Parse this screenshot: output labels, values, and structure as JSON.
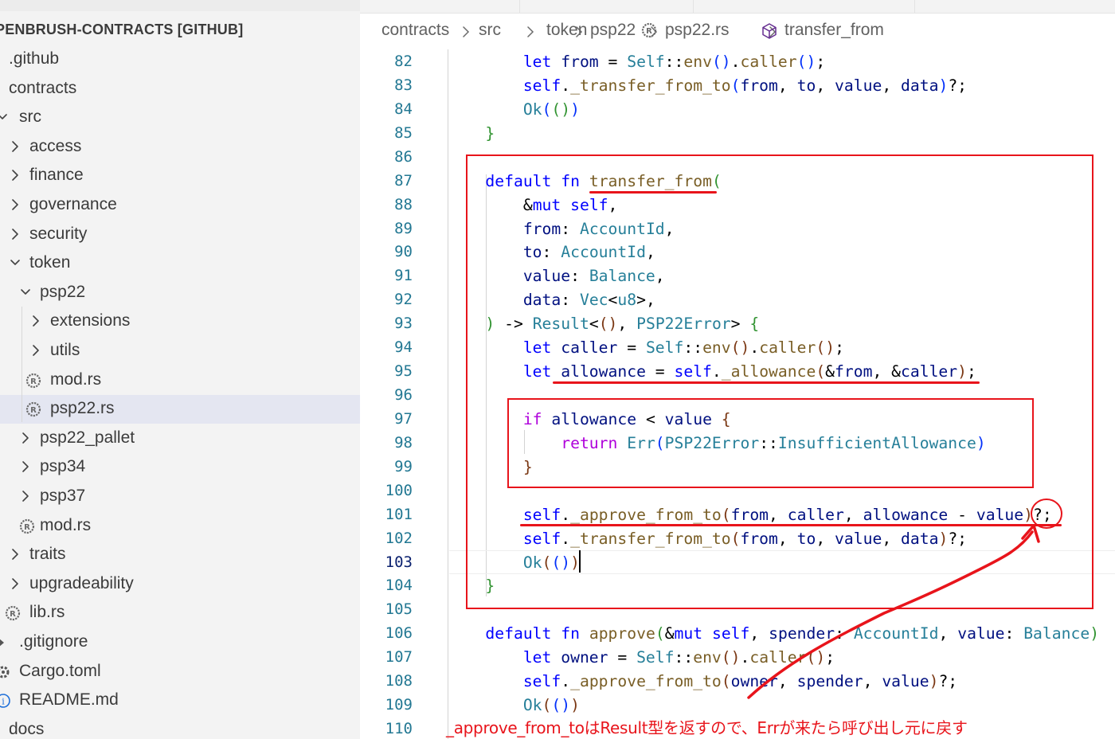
{
  "explorer": {
    "root_title": "PENBRUSH-CONTRACTS [GITHUB]",
    "items": [
      {
        "label": ".github",
        "depth": 0,
        "kind": "folder",
        "expanded": false
      },
      {
        "label": "contracts",
        "depth": 0,
        "kind": "folder",
        "expanded": true
      },
      {
        "label": "src",
        "depth": 1,
        "kind": "folder",
        "expanded": true
      },
      {
        "label": "access",
        "depth": 2,
        "kind": "folder",
        "expanded": false
      },
      {
        "label": "finance",
        "depth": 2,
        "kind": "folder",
        "expanded": false
      },
      {
        "label": "governance",
        "depth": 2,
        "kind": "folder",
        "expanded": false
      },
      {
        "label": "security",
        "depth": 2,
        "kind": "folder",
        "expanded": false
      },
      {
        "label": "token",
        "depth": 2,
        "kind": "folder",
        "expanded": true
      },
      {
        "label": "psp22",
        "depth": 3,
        "kind": "folder",
        "expanded": true
      },
      {
        "label": "extensions",
        "depth": 4,
        "kind": "folder",
        "expanded": false
      },
      {
        "label": "utils",
        "depth": 4,
        "kind": "folder",
        "expanded": false
      },
      {
        "label": "mod.rs",
        "depth": 4,
        "kind": "rust-file"
      },
      {
        "label": "psp22.rs",
        "depth": 4,
        "kind": "rust-file",
        "selected": true
      },
      {
        "label": "psp22_pallet",
        "depth": 3,
        "kind": "folder",
        "expanded": false
      },
      {
        "label": "psp34",
        "depth": 3,
        "kind": "folder",
        "expanded": false
      },
      {
        "label": "psp37",
        "depth": 3,
        "kind": "folder",
        "expanded": false
      },
      {
        "label": "mod.rs",
        "depth": 3,
        "kind": "rust-file"
      },
      {
        "label": "traits",
        "depth": 2,
        "kind": "folder",
        "expanded": false
      },
      {
        "label": "upgradeability",
        "depth": 2,
        "kind": "folder",
        "expanded": false
      },
      {
        "label": "lib.rs",
        "depth": 1,
        "kind": "rust-file"
      },
      {
        "label": ".gitignore",
        "depth": 1,
        "kind": "git-file"
      },
      {
        "label": "Cargo.toml",
        "depth": 1,
        "kind": "toml-file"
      },
      {
        "label": "README.md",
        "depth": 1,
        "kind": "info-file"
      },
      {
        "label": "docs",
        "depth": 0,
        "kind": "folder",
        "expanded": false
      }
    ]
  },
  "breadcrumb": {
    "items": [
      "contracts",
      "src",
      "token",
      "psp22",
      "psp22.rs",
      "transfer_from"
    ]
  },
  "editor": {
    "current_line": 103,
    "lines": [
      {
        "n": 82,
        "tokens": [
          [
            "pn",
            "        "
          ],
          [
            "kw",
            "let"
          ],
          [
            "pn",
            " "
          ],
          [
            "vr",
            "from"
          ],
          [
            "pn",
            " = "
          ],
          [
            "ty",
            "Self"
          ],
          [
            "pn",
            "::"
          ],
          [
            "fn",
            "env"
          ],
          [
            "b1",
            "("
          ],
          [
            "b1",
            ")"
          ],
          [
            "pn",
            "."
          ],
          [
            "fn",
            "caller"
          ],
          [
            "b1",
            "("
          ],
          [
            "b1",
            ")"
          ],
          [
            "pn",
            ";"
          ]
        ]
      },
      {
        "n": 83,
        "tokens": [
          [
            "pn",
            "        "
          ],
          [
            "kw",
            "self"
          ],
          [
            "pn",
            "."
          ],
          [
            "fn",
            "_transfer_from_to"
          ],
          [
            "b1",
            "("
          ],
          [
            "vr",
            "from"
          ],
          [
            "pn",
            ", "
          ],
          [
            "vr",
            "to"
          ],
          [
            "pn",
            ", "
          ],
          [
            "vr",
            "value"
          ],
          [
            "pn",
            ", "
          ],
          [
            "vr",
            "data"
          ],
          [
            "b1",
            ")"
          ],
          [
            "pn",
            "?;"
          ]
        ]
      },
      {
        "n": 84,
        "tokens": [
          [
            "pn",
            "        "
          ],
          [
            "ty",
            "Ok"
          ],
          [
            "b1",
            "("
          ],
          [
            "b2",
            "("
          ],
          [
            "b2",
            ")"
          ],
          [
            "b1",
            ")"
          ]
        ]
      },
      {
        "n": 85,
        "tokens": [
          [
            "pn",
            "    "
          ],
          [
            "b2",
            "}"
          ]
        ]
      },
      {
        "n": 86,
        "tokens": []
      },
      {
        "n": 87,
        "tokens": [
          [
            "pn",
            "    "
          ],
          [
            "kw",
            "default"
          ],
          [
            "pn",
            " "
          ],
          [
            "kw",
            "fn"
          ],
          [
            "pn",
            " "
          ],
          [
            "fn",
            "transfer_from"
          ],
          [
            "b2",
            "("
          ]
        ]
      },
      {
        "n": 88,
        "tokens": [
          [
            "pn",
            "        &"
          ],
          [
            "kw",
            "mut"
          ],
          [
            "pn",
            " "
          ],
          [
            "kw",
            "self"
          ],
          [
            "pn",
            ","
          ]
        ]
      },
      {
        "n": 89,
        "tokens": [
          [
            "pn",
            "        "
          ],
          [
            "vr",
            "from"
          ],
          [
            "pn",
            ": "
          ],
          [
            "ty",
            "AccountId"
          ],
          [
            "pn",
            ","
          ]
        ]
      },
      {
        "n": 90,
        "tokens": [
          [
            "pn",
            "        "
          ],
          [
            "vr",
            "to"
          ],
          [
            "pn",
            ": "
          ],
          [
            "ty",
            "AccountId"
          ],
          [
            "pn",
            ","
          ]
        ]
      },
      {
        "n": 91,
        "tokens": [
          [
            "pn",
            "        "
          ],
          [
            "vr",
            "value"
          ],
          [
            "pn",
            ": "
          ],
          [
            "ty",
            "Balance"
          ],
          [
            "pn",
            ","
          ]
        ]
      },
      {
        "n": 92,
        "tokens": [
          [
            "pn",
            "        "
          ],
          [
            "vr",
            "data"
          ],
          [
            "pn",
            ": "
          ],
          [
            "ty",
            "Vec"
          ],
          [
            "pn",
            "<"
          ],
          [
            "ty",
            "u8"
          ],
          [
            "pn",
            ">,"
          ]
        ]
      },
      {
        "n": 93,
        "tokens": [
          [
            "pn",
            "    "
          ],
          [
            "b2",
            ")"
          ],
          [
            "pn",
            " -> "
          ],
          [
            "ty",
            "Result"
          ],
          [
            "pn",
            "<"
          ],
          [
            "b3",
            "("
          ],
          [
            "b3",
            ")"
          ],
          [
            "pn",
            ", "
          ],
          [
            "ty",
            "PSP22Error"
          ],
          [
            "pn",
            "> "
          ],
          [
            "b2",
            "{"
          ]
        ]
      },
      {
        "n": 94,
        "tokens": [
          [
            "pn",
            "        "
          ],
          [
            "kw",
            "let"
          ],
          [
            "pn",
            " "
          ],
          [
            "vr",
            "caller"
          ],
          [
            "pn",
            " = "
          ],
          [
            "ty",
            "Self"
          ],
          [
            "pn",
            "::"
          ],
          [
            "fn",
            "env"
          ],
          [
            "b3",
            "("
          ],
          [
            "b3",
            ")"
          ],
          [
            "pn",
            "."
          ],
          [
            "fn",
            "caller"
          ],
          [
            "b3",
            "("
          ],
          [
            "b3",
            ")"
          ],
          [
            "pn",
            ";"
          ]
        ]
      },
      {
        "n": 95,
        "tokens": [
          [
            "pn",
            "        "
          ],
          [
            "kw",
            "let"
          ],
          [
            "pn",
            " "
          ],
          [
            "vr",
            "allowance"
          ],
          [
            "pn",
            " = "
          ],
          [
            "kw",
            "self"
          ],
          [
            "pn",
            "."
          ],
          [
            "fn",
            "_allowance"
          ],
          [
            "b3",
            "("
          ],
          [
            "pn",
            "&"
          ],
          [
            "vr",
            "from"
          ],
          [
            "pn",
            ", &"
          ],
          [
            "vr",
            "caller"
          ],
          [
            "b3",
            ")"
          ],
          [
            "pn",
            ";"
          ]
        ]
      },
      {
        "n": 96,
        "tokens": []
      },
      {
        "n": 97,
        "tokens": [
          [
            "pn",
            "        "
          ],
          [
            "ctl",
            "if"
          ],
          [
            "pn",
            " "
          ],
          [
            "vr",
            "allowance"
          ],
          [
            "pn",
            " < "
          ],
          [
            "vr",
            "value"
          ],
          [
            "pn",
            " "
          ],
          [
            "b3",
            "{"
          ]
        ]
      },
      {
        "n": 98,
        "tokens": [
          [
            "pn",
            "            "
          ],
          [
            "ctl",
            "return"
          ],
          [
            "pn",
            " "
          ],
          [
            "ty",
            "Err"
          ],
          [
            "b1",
            "("
          ],
          [
            "ty",
            "PSP22Error"
          ],
          [
            "pn",
            "::"
          ],
          [
            "ty",
            "InsufficientAllowance"
          ],
          [
            "b1",
            ")"
          ]
        ]
      },
      {
        "n": 99,
        "tokens": [
          [
            "pn",
            "        "
          ],
          [
            "b3",
            "}"
          ]
        ]
      },
      {
        "n": 100,
        "tokens": []
      },
      {
        "n": 101,
        "tokens": [
          [
            "pn",
            "        "
          ],
          [
            "kw",
            "self"
          ],
          [
            "pn",
            "."
          ],
          [
            "fn",
            "_approve_from_to"
          ],
          [
            "b3",
            "("
          ],
          [
            "vr",
            "from"
          ],
          [
            "pn",
            ", "
          ],
          [
            "vr",
            "caller"
          ],
          [
            "pn",
            ", "
          ],
          [
            "vr",
            "allowance"
          ],
          [
            "pn",
            " - "
          ],
          [
            "vr",
            "value"
          ],
          [
            "b3",
            ")"
          ],
          [
            "pn",
            "?;"
          ]
        ]
      },
      {
        "n": 102,
        "tokens": [
          [
            "pn",
            "        "
          ],
          [
            "kw",
            "self"
          ],
          [
            "pn",
            "."
          ],
          [
            "fn",
            "_transfer_from_to"
          ],
          [
            "b3",
            "("
          ],
          [
            "vr",
            "from"
          ],
          [
            "pn",
            ", "
          ],
          [
            "vr",
            "to"
          ],
          [
            "pn",
            ", "
          ],
          [
            "vr",
            "value"
          ],
          [
            "pn",
            ", "
          ],
          [
            "vr",
            "data"
          ],
          [
            "b3",
            ")"
          ],
          [
            "pn",
            "?;"
          ]
        ]
      },
      {
        "n": 103,
        "tokens": [
          [
            "pn",
            "        "
          ],
          [
            "ty",
            "Ok"
          ],
          [
            "b3",
            "("
          ],
          [
            "b1",
            "("
          ],
          [
            "b1",
            ")"
          ],
          [
            "b3",
            ")"
          ]
        ]
      },
      {
        "n": 104,
        "tokens": [
          [
            "pn",
            "    "
          ],
          [
            "b2",
            "}"
          ]
        ]
      },
      {
        "n": 105,
        "tokens": []
      },
      {
        "n": 106,
        "tokens": [
          [
            "pn",
            "    "
          ],
          [
            "kw",
            "default"
          ],
          [
            "pn",
            " "
          ],
          [
            "kw",
            "fn"
          ],
          [
            "pn",
            " "
          ],
          [
            "fn",
            "approve"
          ],
          [
            "b2",
            "("
          ],
          [
            "pn",
            "&"
          ],
          [
            "kw",
            "mut"
          ],
          [
            "pn",
            " "
          ],
          [
            "kw",
            "self"
          ],
          [
            "pn",
            ", "
          ],
          [
            "vr",
            "spender"
          ],
          [
            "pn",
            ": "
          ],
          [
            "ty",
            "AccountId"
          ],
          [
            "pn",
            ", "
          ],
          [
            "vr",
            "value"
          ],
          [
            "pn",
            ": "
          ],
          [
            "ty",
            "Balance"
          ],
          [
            "b2",
            ")"
          ]
        ]
      },
      {
        "n": 107,
        "tokens": [
          [
            "pn",
            "        "
          ],
          [
            "kw",
            "let"
          ],
          [
            "pn",
            " "
          ],
          [
            "vr",
            "owner"
          ],
          [
            "pn",
            " = "
          ],
          [
            "ty",
            "Self"
          ],
          [
            "pn",
            "::"
          ],
          [
            "fn",
            "env"
          ],
          [
            "b3",
            "("
          ],
          [
            "b3",
            ")"
          ],
          [
            "pn",
            "."
          ],
          [
            "fn",
            "caller"
          ],
          [
            "b3",
            "("
          ],
          [
            "b3",
            ")"
          ],
          [
            "pn",
            ";"
          ]
        ]
      },
      {
        "n": 108,
        "tokens": [
          [
            "pn",
            "        "
          ],
          [
            "kw",
            "self"
          ],
          [
            "pn",
            "."
          ],
          [
            "fn",
            "_approve_from_to"
          ],
          [
            "b3",
            "("
          ],
          [
            "vr",
            "owner"
          ],
          [
            "pn",
            ", "
          ],
          [
            "vr",
            "spender"
          ],
          [
            "pn",
            ", "
          ],
          [
            "vr",
            "value"
          ],
          [
            "b3",
            ")"
          ],
          [
            "pn",
            "?;"
          ]
        ]
      },
      {
        "n": 109,
        "tokens": [
          [
            "pn",
            "        "
          ],
          [
            "ty",
            "Ok"
          ],
          [
            "b3",
            "("
          ],
          [
            "b1",
            "("
          ],
          [
            "b1",
            ")"
          ],
          [
            "b3",
            ")"
          ]
        ]
      },
      {
        "n": 110,
        "tokens": []
      }
    ]
  },
  "annotation": {
    "note": "_approve_from_toはResult型を返すので、Errが来たら呼び出し元に戻す",
    "color": "#e8141b"
  },
  "colors": {
    "sidebar_bg": "#f3f3f3",
    "selected_row": "#e4e6f1",
    "line_number": "#237893",
    "keyword": "#0000ff",
    "function": "#795e26",
    "type": "#267f99",
    "variable": "#001080",
    "control": "#af00db"
  }
}
